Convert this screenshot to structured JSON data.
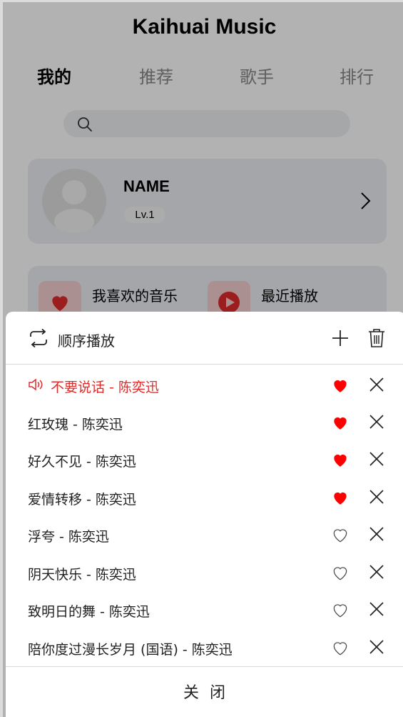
{
  "app": {
    "title": "Kaihuai Music"
  },
  "tabs": [
    {
      "label": "我的",
      "active": true
    },
    {
      "label": "推荐",
      "active": false
    },
    {
      "label": "歌手",
      "active": false
    },
    {
      "label": "排行",
      "active": false
    }
  ],
  "search": {
    "icon": "search-icon",
    "placeholder": ""
  },
  "profile": {
    "name": "NAME",
    "level": "Lv.1",
    "icon": "chevron-right-icon"
  },
  "quick": [
    {
      "label": "我喜欢的音乐",
      "sub": "",
      "icon": "heart-icon"
    },
    {
      "label": "最近播放",
      "sub": "",
      "icon": "play-icon"
    }
  ],
  "playlist": {
    "mode_label": "顺序播放",
    "mode_icon": "repeat-icon",
    "songs": [
      {
        "title": "不要说话 - 陈奕迅",
        "playing": true,
        "liked": true
      },
      {
        "title": "红玫瑰 - 陈奕迅",
        "playing": false,
        "liked": true
      },
      {
        "title": "好久不见 - 陈奕迅",
        "playing": false,
        "liked": true
      },
      {
        "title": "爱情转移 - 陈奕迅",
        "playing": false,
        "liked": true
      },
      {
        "title": "浮夸 - 陈奕迅",
        "playing": false,
        "liked": false
      },
      {
        "title": "阴天快乐 - 陈奕迅",
        "playing": false,
        "liked": false
      },
      {
        "title": "致明日的舞 - 陈奕迅",
        "playing": false,
        "liked": false
      },
      {
        "title": "陪你度过漫长岁月 (国语) - 陈奕迅",
        "playing": false,
        "liked": false
      }
    ],
    "close_label": "关 闭"
  },
  "colors": {
    "accent": "#e02a2a",
    "liked": "#ff0000",
    "overlay": "rgba(0,0,0,0.30)"
  }
}
